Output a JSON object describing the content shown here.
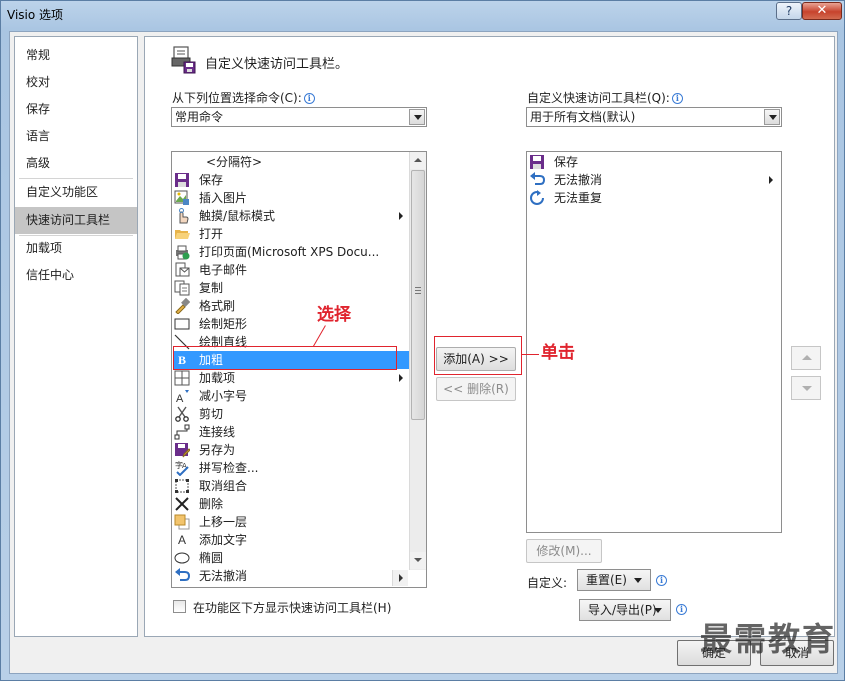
{
  "window": {
    "title": "Visio 选项",
    "help": "?",
    "close": "✕"
  },
  "nav": {
    "items": [
      {
        "label": "常规"
      },
      {
        "label": "校对"
      },
      {
        "label": "保存"
      },
      {
        "label": "语言"
      },
      {
        "label": "高级"
      },
      {
        "label": "自定义功能区"
      },
      {
        "label": "快速访问工具栏",
        "selected": true
      },
      {
        "label": "加载项"
      },
      {
        "label": "信任中心"
      }
    ]
  },
  "main": {
    "heading": "自定义快速访问工具栏。",
    "choose_label": "从下列位置选择命令(C):",
    "choose_value": "常用命令",
    "customize_label": "自定义快速访问工具栏(Q):",
    "customize_value": "用于所有文档(默认)",
    "commands": [
      {
        "icon": "separator",
        "label": "<分隔符>"
      },
      {
        "icon": "save-icon",
        "label": "保存"
      },
      {
        "icon": "insert-picture-icon",
        "label": "插入图片"
      },
      {
        "icon": "touch-mode-icon",
        "label": "触摸/鼠标模式",
        "submenu": true
      },
      {
        "icon": "open-folder-icon",
        "label": "打开"
      },
      {
        "icon": "print-page-icon",
        "label": "打印页面(Microsoft XPS Docu..."
      },
      {
        "icon": "email-icon",
        "label": "电子邮件"
      },
      {
        "icon": "copy-icon",
        "label": "复制"
      },
      {
        "icon": "format-painter-icon",
        "label": "格式刷"
      },
      {
        "icon": "rectangle-icon",
        "label": "绘制矩形"
      },
      {
        "icon": "line-icon",
        "label": "绘制直线"
      },
      {
        "icon": "bold-icon",
        "label": "加粗",
        "selected": true
      },
      {
        "icon": "addins-icon",
        "label": "加载项",
        "submenu": true
      },
      {
        "icon": "shrink-font-icon",
        "label": "减小字号"
      },
      {
        "icon": "scissors-icon",
        "label": "剪切"
      },
      {
        "icon": "connector-icon",
        "label": "连接线"
      },
      {
        "icon": "save-as-icon",
        "label": "另存为"
      },
      {
        "icon": "spell-check-icon",
        "label": "拼写检查..."
      },
      {
        "icon": "ungroup-icon",
        "label": "取消组合"
      },
      {
        "icon": "delete-icon",
        "label": "删除"
      },
      {
        "icon": "bring-forward-icon",
        "label": "上移一层"
      },
      {
        "icon": "add-text-icon",
        "label": "添加文字"
      },
      {
        "icon": "ellipse-icon",
        "label": "椭圆"
      },
      {
        "icon": "undo-icon",
        "label": "无法撤消",
        "submenu": true
      }
    ],
    "toolbar_items": [
      {
        "icon": "save-icon",
        "label": "保存"
      },
      {
        "icon": "undo-icon",
        "label": "无法撤消",
        "submenu": true
      },
      {
        "icon": "redo-icon",
        "label": "无法重复"
      }
    ],
    "add_button": "添加(A) >>",
    "remove_button": "<< 删除(R)",
    "modify_button": "修改(M)...",
    "customize_text": "自定义:",
    "reset_button": "重置(E)",
    "import_export_button": "导入/导出(P)",
    "show_below_label": "在功能区下方显示快速访问工具栏(H)"
  },
  "annotations": {
    "select": "选择",
    "click": "单击"
  },
  "footer": {
    "ok": "确定",
    "cancel": "取消"
  },
  "watermark": "最需教育",
  "colors": {
    "selection": "#3399ff",
    "annotation": "#e0242e",
    "nav_selected": "#c5c5c5"
  }
}
